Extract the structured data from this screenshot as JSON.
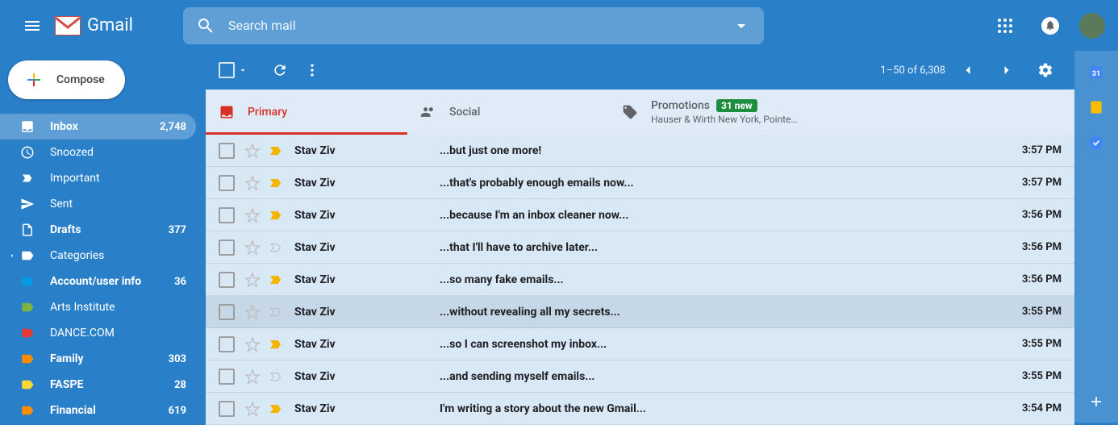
{
  "header": {
    "app_name": "Gmail",
    "search_placeholder": "Search mail"
  },
  "compose": {
    "label": "Compose"
  },
  "sidebar": {
    "items": [
      {
        "label": "Inbox",
        "count": "2,748",
        "icon": "inbox"
      },
      {
        "label": "Snoozed",
        "count": "",
        "icon": "clock"
      },
      {
        "label": "Important",
        "count": "",
        "icon": "important"
      },
      {
        "label": "Sent",
        "count": "",
        "icon": "sent"
      },
      {
        "label": "Drafts",
        "count": "377",
        "icon": "file"
      },
      {
        "label": "Categories",
        "count": "",
        "icon": "label"
      },
      {
        "label": "Account/user info",
        "count": "36",
        "icon": "label",
        "color": "#039be5"
      },
      {
        "label": "Arts Institute",
        "count": "",
        "icon": "label",
        "color": "#7cb342"
      },
      {
        "label": "DANCE.COM",
        "count": "",
        "icon": "label",
        "color": "#e53935"
      },
      {
        "label": "Family",
        "count": "303",
        "icon": "label",
        "color": "#fb8c00"
      },
      {
        "label": "FASPE",
        "count": "28",
        "icon": "label",
        "color": "#fdd835"
      },
      {
        "label": "Financial",
        "count": "619",
        "icon": "label",
        "color": "#fb8c00"
      }
    ]
  },
  "toolbar": {
    "range": "1–50 of 6,308"
  },
  "tabs": {
    "primary": "Primary",
    "social": "Social",
    "promotions": "Promotions",
    "promo_badge": "31 new",
    "promo_sub": "Hauser & Wirth New York, Pointe…"
  },
  "emails": [
    {
      "sender": "Stav Ziv",
      "subject": "...but just one more!",
      "time": "3:57 PM",
      "important": true
    },
    {
      "sender": "Stav Ziv",
      "subject": "...that's probably enough emails now...",
      "time": "3:57 PM",
      "important": true
    },
    {
      "sender": "Stav Ziv",
      "subject": "...because I'm an inbox cleaner now...",
      "time": "3:56 PM",
      "important": true
    },
    {
      "sender": "Stav Ziv",
      "subject": "...that I'll have to archive later...",
      "time": "3:56 PM",
      "important": false
    },
    {
      "sender": "Stav Ziv",
      "subject": "...so many fake emails...",
      "time": "3:56 PM",
      "important": true
    },
    {
      "sender": "Stav Ziv",
      "subject": "...without revealing all my secrets...",
      "time": "3:55 PM",
      "important": false,
      "hovered": true
    },
    {
      "sender": "Stav Ziv",
      "subject": "...so I can screenshot my inbox...",
      "time": "3:55 PM",
      "important": true
    },
    {
      "sender": "Stav Ziv",
      "subject": "...and sending myself emails...",
      "time": "3:55 PM",
      "important": false
    },
    {
      "sender": "Stav Ziv",
      "subject": "I'm writing a story about the new Gmail...",
      "time": "3:54 PM",
      "important": true
    }
  ]
}
